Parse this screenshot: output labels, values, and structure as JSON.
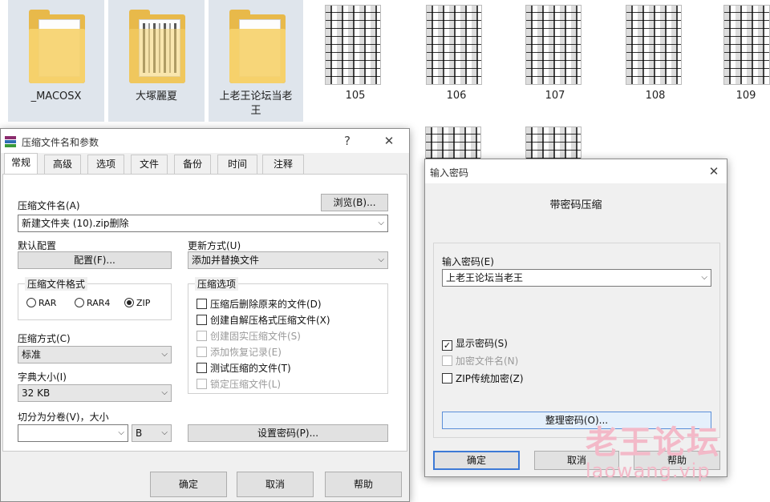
{
  "explorer": {
    "folders": [
      {
        "label": "_MACOSX",
        "selected": true
      },
      {
        "label": "大塚麗夏",
        "selected": true
      },
      {
        "label": "上老王论坛当老王",
        "selected": true
      }
    ],
    "images": [
      "105",
      "106",
      "107",
      "108",
      "109"
    ]
  },
  "archive_dialog": {
    "title": "压缩文件名和参数",
    "help_icon": "?",
    "close_icon": "✕",
    "tabs": [
      "常规",
      "高级",
      "选项",
      "文件",
      "备份",
      "时间",
      "注释"
    ],
    "active_tab": "常规",
    "archive_name_label": "压缩文件名(A)",
    "browse_label": "浏览(B)...",
    "archive_name_value": "新建文件夹 (10).zip删除",
    "default_profile_label": "默认配置",
    "profiles_button": "配置(F)...",
    "update_mode_label": "更新方式(U)",
    "update_mode_value": "添加并替换文件",
    "format_group_label": "压缩文件格式",
    "formats": [
      "RAR",
      "RAR4",
      "ZIP"
    ],
    "selected_format": "ZIP",
    "options_group_label": "压缩选项",
    "options": [
      {
        "label": "压缩后删除原来的文件(D)",
        "checked": false,
        "enabled": true
      },
      {
        "label": "创建自解压格式压缩文件(X)",
        "checked": false,
        "enabled": true
      },
      {
        "label": "创建固实压缩文件(S)",
        "checked": false,
        "enabled": false
      },
      {
        "label": "添加恢复记录(E)",
        "checked": false,
        "enabled": false
      },
      {
        "label": "测试压缩的文件(T)",
        "checked": false,
        "enabled": true
      },
      {
        "label": "锁定压缩文件(L)",
        "checked": false,
        "enabled": false
      }
    ],
    "method_label": "压缩方式(C)",
    "method_value": "标准",
    "dict_label": "字典大小(I)",
    "dict_value": "32 KB",
    "split_label": "切分为分卷(V)，大小",
    "split_value": "",
    "split_unit": "B",
    "set_password_button": "设置密码(P)...",
    "ok": "确定",
    "cancel": "取消",
    "help": "帮助"
  },
  "password_dialog": {
    "title": "输入密码",
    "close_icon": "✕",
    "heading": "带密码压缩",
    "enter_label": "输入密码(E)",
    "password_value": "上老王论坛当老王",
    "show_password": {
      "label": "显示密码(S)",
      "checked": true,
      "enabled": true
    },
    "encrypt_names": {
      "label": "加密文件名(N)",
      "checked": false,
      "enabled": false
    },
    "zip_legacy": {
      "label": "ZIP传统加密(Z)",
      "checked": false,
      "enabled": true
    },
    "organize_button": "整理密码(O)...",
    "ok": "确定",
    "cancel": "取消",
    "help": "帮助"
  },
  "watermark": {
    "text": "老王论坛",
    "sub": "laowang.vip"
  }
}
